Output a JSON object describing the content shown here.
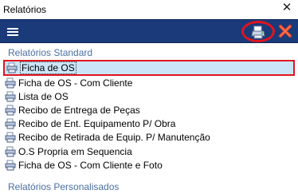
{
  "window": {
    "title": "Relatórios",
    "close_glyph": "✕"
  },
  "toolbar": {
    "menu_icon": "hamburger-icon",
    "print_icon": "printer-icon",
    "delete_icon": "red-x-icon"
  },
  "sections": {
    "standard_title": "Relatórios Standard",
    "custom_title": "Relatórios Personalisados"
  },
  "reports": [
    {
      "label": "Ficha de OS",
      "selected": true
    },
    {
      "label": "Ficha de OS - Com Cliente"
    },
    {
      "label": "Lista de OS"
    },
    {
      "label": "Recibo de Entrega de Peças"
    },
    {
      "label": "Recibo de Ent. Equipamento P/ Obra"
    },
    {
      "label": "Recibo de Retirada de Equip. P/ Manutenção"
    },
    {
      "label": "O.S Propria em Sequencia"
    },
    {
      "label": "Ficha de OS - Com Cliente e Foto"
    }
  ],
  "colors": {
    "toolbar": "#1b3a7a",
    "highlight": "#e0141e",
    "section_text": "#4a6fa5",
    "selection": "#cce4f7"
  }
}
